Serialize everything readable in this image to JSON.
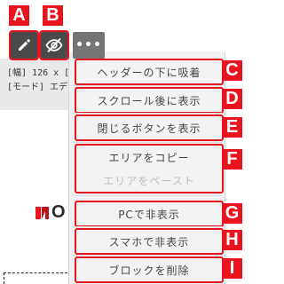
{
  "toolbar": {
    "edit_icon": "pencil-icon",
    "hide_icon": "eye-off-icon",
    "more_label": "•••"
  },
  "markers": {
    "a": "A",
    "b": "B",
    "c": "C",
    "d": "D",
    "e": "E",
    "f": "F",
    "g": "G",
    "h": "H",
    "i": "I"
  },
  "block_info": {
    "line1": "[幅] 126 x [高",
    "line2": "[モード] エデ"
  },
  "menu": {
    "header_sticky": "ヘッダーの下に吸着",
    "show_after_scroll": "スクロール後に表示",
    "show_close_button": "閉じるボタンを表示",
    "copy_area": "エリアをコピー",
    "paste_area": "エリアをペースト",
    "hide_on_pc": "PCで非表示",
    "hide_on_smartphone": "スマホで非表示",
    "delete_block": "ブロックを削除"
  },
  "background": {
    "logo_fragment": "O"
  },
  "colors": {
    "accent_red": "#e8141e",
    "toolbar_dark": "#4a4a4a",
    "toolbar_gray": "#757575",
    "menu_bg": "#f1f1f1"
  }
}
